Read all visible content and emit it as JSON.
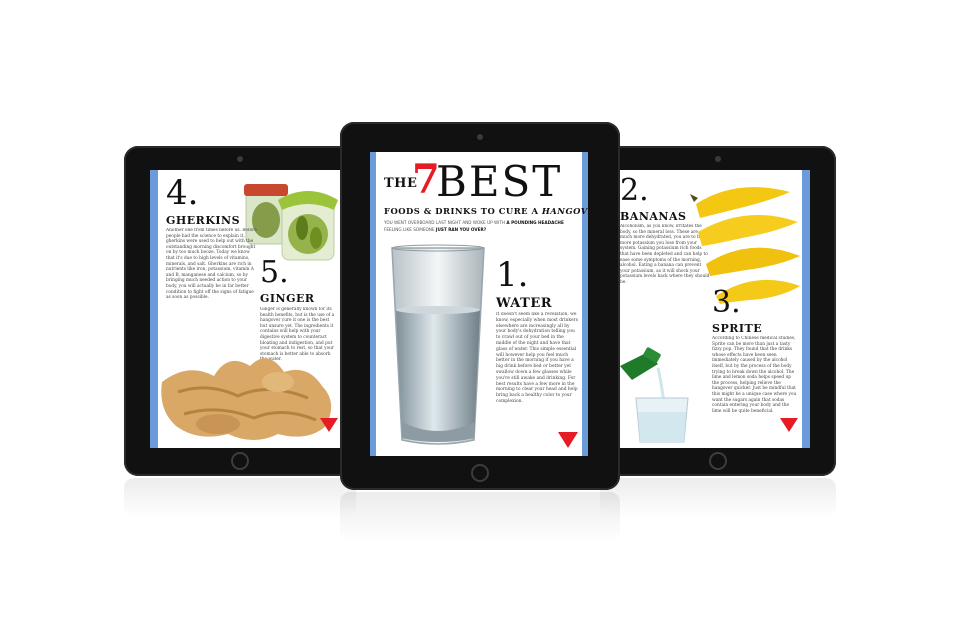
{
  "left_tablet": {
    "item4_number": "4.",
    "item4_title": "GHERKINS",
    "item4_body": "Another one from times before us. Before people had the science to explain it, gherkins were used to help out with the outstanding morning discomfort brought on by too much booze. Today we know that it's due to high levels of vitamins, minerals, and salt. Gherkins are rich in nutrients like iron, potassium, vitamin A and B, manganese and calcium, so by bringing much needed action to your body, you will actually be in far better condition to fight off the signs of fatigue as soon as possible.",
    "item5_number": "5.",
    "item5_title": "GINGER",
    "item5_body": "Ginger is generally known for its health benefits, but is the use of a hangover cure it one is the best but unsure yet. The ingredients it contains will help with your digestive system to counteract bloating and indigestion, and put your stomach to rest, so that your stomach is better able to absorb the water."
  },
  "center_tablet": {
    "title_the": "THE",
    "title_number": "7",
    "title_best": "BEST",
    "subtitle": "FOODS & DRINKS TO CURE A",
    "subtitle_em": "HANGOVER",
    "intro": "YOU WENT OVERBOARD LAST NIGHT AND WOKE UP WITH",
    "intro_bold": "A POUNDING HEADACHE",
    "intro2": "FEELING LIKE SOMEONE",
    "intro2_bold": "JUST RAN YOU OVER?",
    "item1_number": "1.",
    "item1_title": "WATER",
    "item1_body": "It doesn't seem like a revelation, we know, especially when most drinkers elsewhere are increasingly all by your body's dehydration telling you to crawl out of your bed in the middle of the night and have that glass of water. This simple essential will however help you feel much better in the morning if you have a big drink before bed or better yet swallow down a few glasses while you're still awake and drinking. For best results have a few more in the morning to clear your head and help bring back a healthy color to your complexion."
  },
  "right_tablet": {
    "item2_number": "2.",
    "item2_title": "BANANAS",
    "item2_body": "Alcoholism, as you know, irritates the body, so the mineral loss. These are much more dehydrated, you are to be more potassium you lose from your system. Gaining potassium rich foods that have been depleted and can help to ease some symptoms of the morning, alcohol. Eating a banana can prevent your potassium, as it will shock your potassium levels back where they should be.",
    "item3_number": "3.",
    "item3_title": "SPRITE",
    "item3_body": "According to Chinese medical studies, Sprite can be more than just a tasty fizzy pop. They found that the drinks whose effects have been seen immediately caused by the alcohol itself, but by the process of the body trying to break down the alcohol. The lime and lemon soda helps speed up the process, helping relieve the hangover quicker. Just be mindful that this might be a unique case where you want the sugars again that sodas contain entering your body and the lime will be quite beneficial."
  },
  "colors": {
    "accent_red": "#e51c23",
    "side_blue": "#6b9bd8"
  }
}
